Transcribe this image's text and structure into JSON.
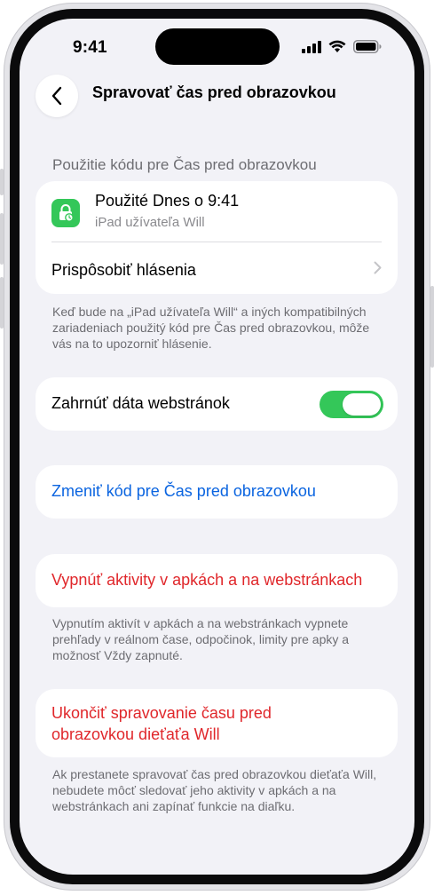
{
  "status_bar": {
    "time": "9:41"
  },
  "nav": {
    "title": "Spravovať čas pred obrazovkou"
  },
  "section": {
    "header": "Použitie kódu pre Čas pred obrazovkou"
  },
  "usage_card": {
    "title": "Použité Dnes o 9:41",
    "subtitle": "iPad užívateľa Will",
    "customize_label": "Prispôsobiť hlásenia"
  },
  "usage_footnote": "Keď bude na „iPad užívateľa Will“ a iných kompatibilných zariadeniach použitý kód pre Čas pred obrazovkou, môže vás na to upozorniť hlásenie.",
  "website_data": {
    "label": "Zahrnúť dáta webstránok",
    "enabled": true
  },
  "change_code": {
    "label": "Zmeniť kód pre Čas pred obrazovkou"
  },
  "turn_off_activities": {
    "label": "Vypnúť aktivity v apkách a na webstránkach",
    "footnote": "Vypnutím aktivít v apkách a na webstránkach vypnete prehľady v reálnom čase, odpočinok, limity pre apky a možnosť Vždy zapnuté."
  },
  "stop_managing": {
    "label_line1": "Ukončiť spravovanie času pred",
    "label_line2": "obrazovkou dieťaťa Will",
    "footnote": "Ak prestanete spravovať čas pred obrazovkou dieťaťa Will, nebudete môcť sledovať jeho aktivity v apkách a na webstránkach ani zapínať funkcie na diaľku."
  },
  "colors": {
    "accent_blue": "#0a64e0",
    "destructive_red": "#e0272b",
    "toggle_green": "#34c759",
    "background": "#f2f2f7"
  },
  "icons": [
    "back-chevron-icon",
    "lock-clock-icon",
    "chevron-right-icon",
    "cellular-signal-icon",
    "wifi-icon",
    "battery-icon"
  ]
}
